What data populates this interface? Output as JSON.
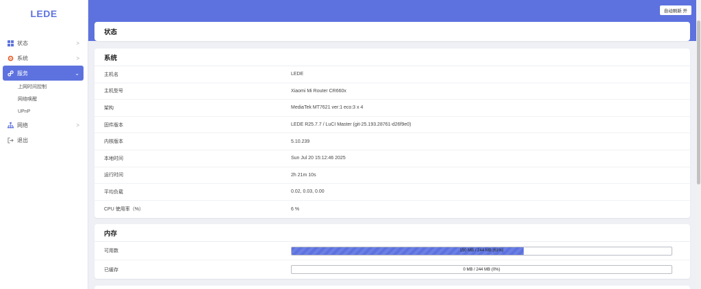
{
  "brand": "LEDE",
  "auto_refresh": "自动刷新 开",
  "sidebar": {
    "items": [
      {
        "label": "状态",
        "icon": "dashboard-icon",
        "chev": ">"
      },
      {
        "label": "系统",
        "icon": "gear-icon",
        "chev": ">"
      },
      {
        "label": "服务",
        "icon": "link-icon",
        "chev": "⌄"
      },
      {
        "label": "网络",
        "icon": "network-icon",
        "chev": ">"
      },
      {
        "label": "退出",
        "icon": "logout-icon"
      }
    ],
    "service_sub": [
      "上网时间控制",
      "网络唤醒",
      "UPnP"
    ]
  },
  "page_title": "状态",
  "system": {
    "title": "系统",
    "rows": [
      {
        "k": "主机名",
        "v": "LEDE"
      },
      {
        "k": "主机型号",
        "v": "Xiaomi Mi Router CR660x"
      },
      {
        "k": "架构",
        "v": "MediaTek MT7621 ver:1 eco:3 x 4"
      },
      {
        "k": "固件版本",
        "v": "LEDE R25.7.7 / LuCI Master (git-25.193.28761-d26f9e0)"
      },
      {
        "k": "内核版本",
        "v": "5.10.239"
      },
      {
        "k": "本地时间",
        "v": "Sun Jul 20 15:12:46 2025"
      },
      {
        "k": "运行时间",
        "v": "2h 21m 10s"
      },
      {
        "k": "平均负载",
        "v": "0.02, 0.03, 0.00"
      },
      {
        "k": "CPU 使用率（%）",
        "v": "6 %"
      }
    ]
  },
  "memory": {
    "title": "内存",
    "rows": [
      {
        "k": "可用数",
        "text": "150 MB / 244 MB (61%)",
        "percent": 61
      },
      {
        "k": "已缓存",
        "text": "0 MB / 244 MB (0%)",
        "percent": 0
      }
    ]
  },
  "colors": {
    "accent": "#5d72de"
  }
}
